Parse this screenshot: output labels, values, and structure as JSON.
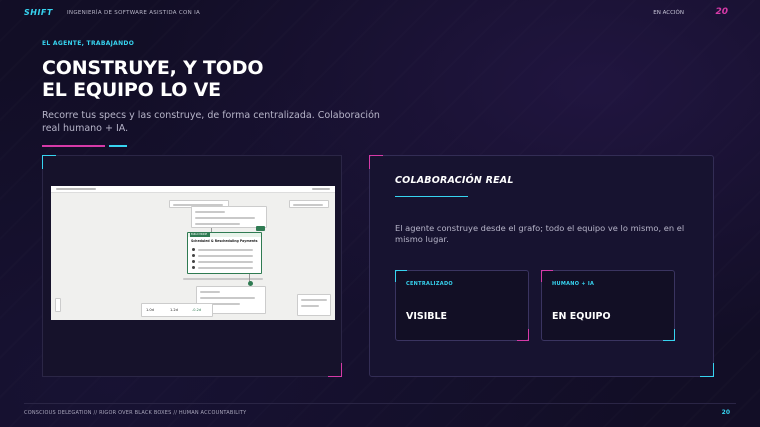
{
  "header": {
    "brand": "SHIFT",
    "tagline": "INGENIERÍA DE SOFTWARE ASISTIDA CON IA",
    "status": "EN ACCIÓN",
    "page": "20"
  },
  "main": {
    "eyebrow": "EL AGENTE, TRABAJANDO",
    "title_line1": "CONSTRUYE, Y TODO",
    "title_line2": "EL EQUIPO LO VE",
    "subtitle": "Recorre tus specs y las construye, de forma centralizada. Colaboración real humano + IA."
  },
  "screenshot": {
    "node_title": "Scheduled & Rescheduling Payments",
    "status_tag": "BUILD MODE",
    "stat_1": "1.0d",
    "stat_2": "1.2d",
    "stat_3": "-0.2d"
  },
  "panel": {
    "title": "COLABORACIÓN REAL",
    "text": "El agente construye desde el grafo; todo el equipo ve lo mismo, en el mismo lugar.",
    "cards": [
      {
        "label": "CENTRALIZADO",
        "value": "VISIBLE"
      },
      {
        "label": "HUMANO + IA",
        "value": "EN EQUIPO"
      }
    ]
  },
  "footer": {
    "text": "CONSCIOUS DELEGATION  //  RIGOR OVER BLACK BOXES  //  HUMAN ACCOUNTABILITY",
    "page": "20"
  },
  "colors": {
    "background": "#120e26",
    "cyan_accent": "#37d4f0",
    "pink_accent": "#d63aa8",
    "text_primary": "#ffffff",
    "text_muted": "#b7b5c9"
  }
}
